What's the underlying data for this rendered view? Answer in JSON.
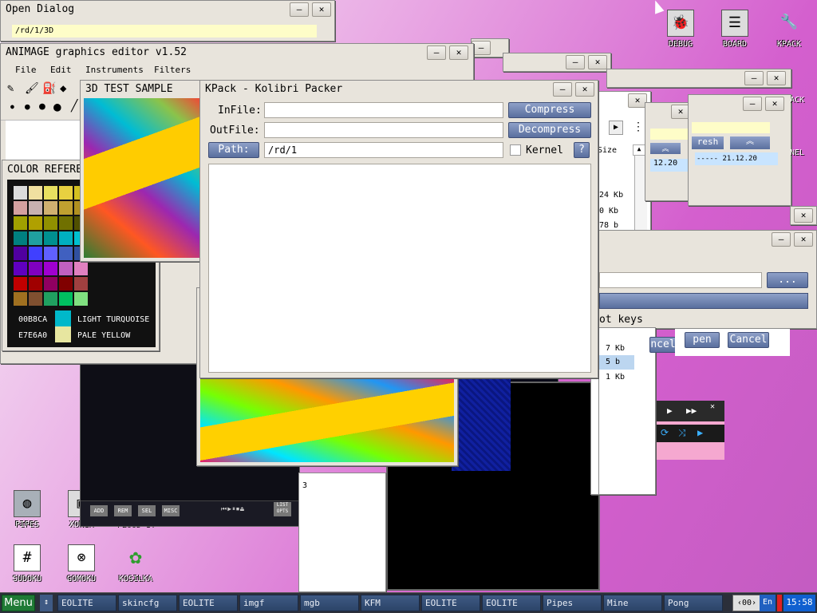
{
  "open_dialog": {
    "title": "Open Dialog",
    "path": "/rd/1/3D",
    "min": "–",
    "close": "✕"
  },
  "animage": {
    "title": "ANIMAGE graphics editor v1.52",
    "menu": [
      "File",
      "Edit",
      "Instruments",
      "Filters"
    ]
  },
  "color_ref": {
    "title": "COLOR REFERE",
    "rows": [
      {
        "code": "00B8CA",
        "name": "LIGHT TURQUOISE",
        "color": "#00b8ca"
      },
      {
        "code": "E7E6A0",
        "name": "PALE YELLOW",
        "color": "#e7e6a0"
      }
    ],
    "palette": [
      "#dcdcdc",
      "#f0e0a0",
      "#e8e060",
      "#e8d040",
      "#d4c020",
      "#d4a0a0",
      "#c8b0b0",
      "#d0b070",
      "#c0a030",
      "#b09020",
      "#a0a000",
      "#b0a000",
      "#909000",
      "#707000",
      "#505000",
      "#008080",
      "#20a0a0",
      "#009090",
      "#00b0c0",
      "#00c0d0",
      "#5000a0",
      "#4040ff",
      "#6060ff",
      "#4060c0",
      "#3050a0",
      "#6000c0",
      "#8000c0",
      "#a000d0",
      "#c060c0",
      "#e080c0",
      "#c00000",
      "#a00000",
      "#900060",
      "#800000",
      "#a04040",
      "#a07020",
      "#805030",
      "#20a060",
      "#00c060",
      "#80e080"
    ]
  },
  "sample_3d": {
    "title": "3D TEST SAMPLE"
  },
  "kpack": {
    "title": "KPack - Kolibri Packer",
    "infile_label": "InFile:",
    "outfile_label": "OutFile:",
    "path_button": "Path:",
    "path_value": "/rd/1",
    "compress": "Compress",
    "decompress": "Decompress",
    "kernel_label": "Kernel",
    "help": "?"
  },
  "kfm": {
    "size_header": "Size",
    "sizes": [
      "24 Kb",
      "0 Kb",
      "78 b"
    ],
    "date": "12.20",
    "refresh": "resh",
    "date2": "----- 21.12.20",
    "menu": "Menu",
    "list2": [
      "7 Kb",
      "5 b",
      "1 Kb"
    ],
    "sel_index": "3"
  },
  "hotkeys": {
    "browse": "...",
    "label": "ot keys",
    "open": "pen",
    "cancel": "Cancel",
    "cancel2": "ncel"
  },
  "player": {
    "buttons": [
      "ADD",
      "REM",
      "SEL",
      "MISC"
    ],
    "list": "LIST OPTS"
  },
  "desktop_icons": [
    {
      "name": "DEBUG",
      "glyph": "🐞"
    },
    {
      "name": "BOARD",
      "glyph": "☰"
    },
    {
      "name": "KPACK",
      "glyph": "🔧"
    },
    {
      "name": "PIPES",
      "glyph": "◍"
    },
    {
      "name": "XONIX",
      "glyph": "▣"
    },
    {
      "name": "FLOOD-IT",
      "glyph": "▦"
    },
    {
      "name": "SUDOKU",
      "glyph": "#"
    },
    {
      "name": "GOMOKU",
      "glyph": "⊗"
    },
    {
      "name": "KOSILKA",
      "glyph": "✿"
    }
  ],
  "taskbar": {
    "menu": "Menu",
    "tasks": [
      "EOLITE",
      "skincfg",
      "EOLITE",
      "imgf",
      "mgb",
      "KFM",
      "EOLITE",
      "EOLITE",
      "Pipes",
      "Mine",
      "Pong"
    ],
    "page": "00",
    "lang": "En",
    "clock": "15:58"
  },
  "colors": {
    "taskbar_bg": "#2b2f3a",
    "accent": "#5a6f9e",
    "menu_green": "#1f7a35"
  }
}
